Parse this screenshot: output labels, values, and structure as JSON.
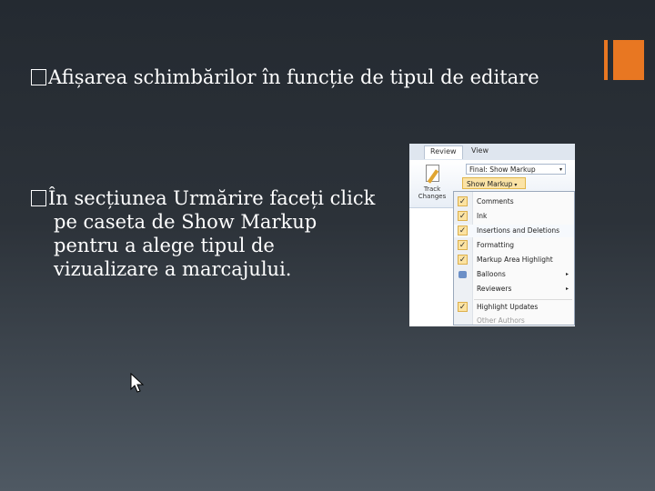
{
  "slide": {
    "bullet1": "Afișarea schimbărilor în funcție de tipul de editare",
    "bullet2_line1": "În secțiunea Urmărire faceți click",
    "bullet2_line2": "pe caseta de Show Markup",
    "bullet2_line3": "pentru a alege tipul de",
    "bullet2_line4": "vizualizare a marcajului."
  },
  "colors": {
    "accent": "#e87722",
    "background_top": "#242a31",
    "background_bottom": "#4f5963"
  },
  "screenshot": {
    "tabs": [
      "Review",
      "View"
    ],
    "track_changes_label_1": "Track",
    "track_changes_label_2": "Changes",
    "final_dropdown": "Final: Show Markup",
    "show_markup_button": "Show Markup",
    "menu": [
      {
        "label": "Comments",
        "checked": true
      },
      {
        "label": "Ink",
        "checked": true
      },
      {
        "label": "Insertions and Deletions",
        "checked": true
      },
      {
        "label": "Formatting",
        "checked": true
      },
      {
        "label": "Markup Area Highlight",
        "checked": true
      },
      {
        "label": "Balloons",
        "checked": false
      },
      {
        "label": "Reviewers",
        "checked": false
      },
      {
        "label": "Highlight Updates",
        "checked": true
      },
      {
        "label": "Other Authors",
        "checked": false
      }
    ]
  }
}
